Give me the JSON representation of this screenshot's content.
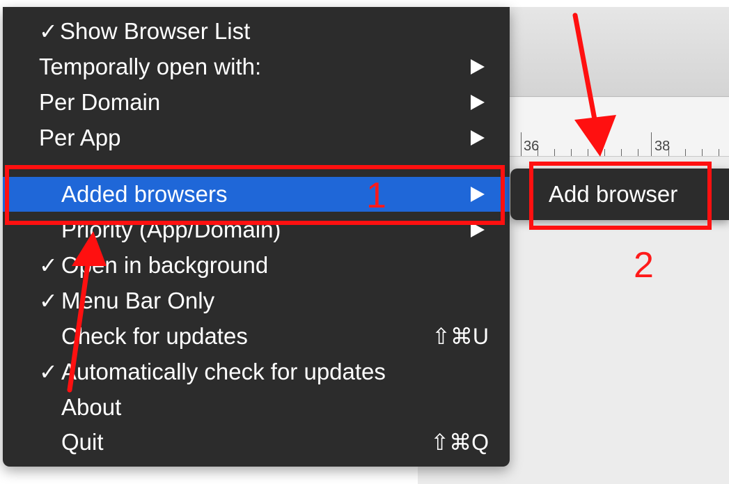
{
  "ruler": {
    "labels": [
      "36",
      "38"
    ]
  },
  "menu": {
    "items": [
      {
        "label": "Show Browser List",
        "checked": true,
        "submenu": false,
        "shortcut": ""
      },
      {
        "label": "Temporally open with:",
        "checked": false,
        "submenu": true,
        "shortcut": ""
      },
      {
        "label": "Per Domain",
        "checked": false,
        "submenu": true,
        "shortcut": ""
      },
      {
        "label": "Per App",
        "checked": false,
        "submenu": true,
        "shortcut": ""
      },
      {
        "label": "Added browsers",
        "checked": false,
        "submenu": true,
        "shortcut": "",
        "highlighted": true
      },
      {
        "label": "Priority (App/Domain)",
        "checked": false,
        "submenu": true,
        "shortcut": ""
      },
      {
        "label": "Open in background",
        "checked": true,
        "submenu": false,
        "shortcut": ""
      },
      {
        "label": "Menu Bar Only",
        "checked": true,
        "submenu": false,
        "shortcut": ""
      },
      {
        "label": "Check for updates",
        "checked": false,
        "submenu": false,
        "shortcut": "⇧⌘U"
      },
      {
        "label": "Automatically check for updates",
        "checked": true,
        "submenu": false,
        "shortcut": ""
      },
      {
        "label": "About",
        "checked": false,
        "submenu": false,
        "shortcut": ""
      },
      {
        "label": "Quit",
        "checked": false,
        "submenu": false,
        "shortcut": "⇧⌘Q"
      }
    ],
    "check_glyph": "✓"
  },
  "submenu": {
    "items": [
      {
        "label": "Add browser"
      }
    ]
  },
  "annotations": {
    "step1": "1",
    "step2": "2",
    "color": "#ff1010"
  },
  "colors": {
    "menu_bg": "#2c2c2c",
    "highlight": "#1f67d8",
    "text": "#ffffff"
  },
  "icons": {
    "submenu_arrow": "triangle-right-icon",
    "checkmark": "checkmark-icon"
  }
}
